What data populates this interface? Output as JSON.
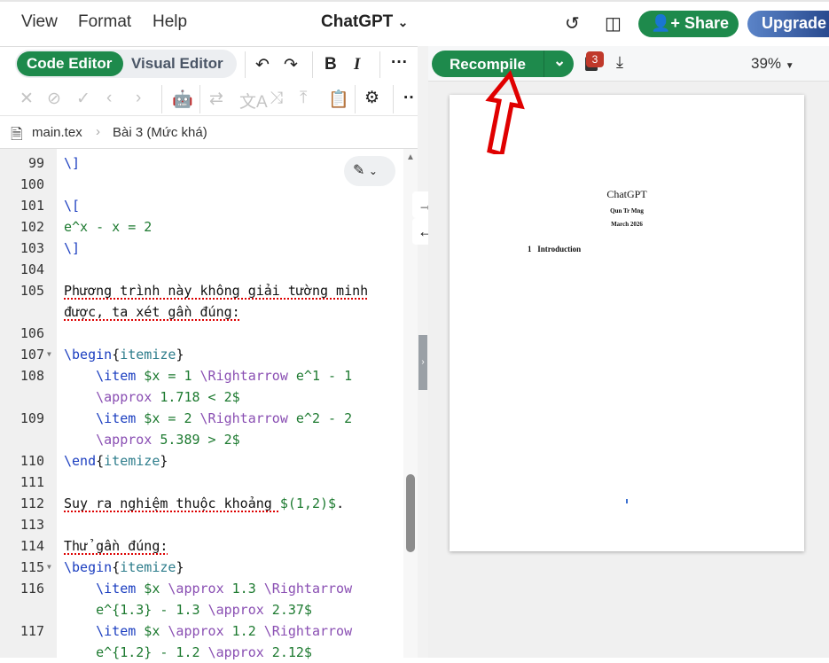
{
  "menu": {
    "items": [
      "View",
      "Format",
      "Help"
    ],
    "project_title": "ChatGPT"
  },
  "header": {
    "share_label": "Share",
    "upgrade_label": "Upgrade"
  },
  "editor": {
    "code_editor_label": "Code Editor",
    "visual_editor_label": "Visual Editor",
    "breadcrumb": {
      "file": "main.tex",
      "section": "Bài 3 (Mức khá)"
    },
    "rows": [
      {
        "num": "99",
        "segs": [
          [
            "\\]",
            "k"
          ]
        ]
      },
      {
        "num": "100",
        "segs": []
      },
      {
        "num": "101",
        "segs": [
          [
            "\\[",
            "k"
          ]
        ]
      },
      {
        "num": "102",
        "segs": [
          [
            "e^x - x = 2",
            "m"
          ]
        ]
      },
      {
        "num": "103",
        "segs": [
          [
            "\\]",
            "k"
          ]
        ]
      },
      {
        "num": "104",
        "segs": []
      },
      {
        "num": "105",
        "segs": [
          [
            "Phương trình này không giải tường minh",
            "sp"
          ]
        ]
      },
      {
        "num": "",
        "segs": [
          [
            "được, ta xét gần đúng:",
            "sp"
          ]
        ]
      },
      {
        "num": "106",
        "segs": []
      },
      {
        "num": "107",
        "fold": true,
        "segs": [
          [
            "\\begin",
            "k"
          ],
          [
            "{",
            ""
          ],
          [
            "itemize",
            "a"
          ],
          [
            "}",
            ""
          ]
        ]
      },
      {
        "num": "108",
        "segs": [
          [
            "    ",
            ""
          ],
          [
            "\\item",
            "k"
          ],
          [
            " $x = 1 ",
            "m"
          ],
          [
            "\\Rightarrow",
            "p"
          ],
          [
            " e^1 - 1",
            "m"
          ]
        ]
      },
      {
        "num": "",
        "segs": [
          [
            "    ",
            ""
          ],
          [
            "\\approx",
            "p"
          ],
          [
            " 1.718 < 2$",
            "m"
          ]
        ]
      },
      {
        "num": "109",
        "segs": [
          [
            "    ",
            ""
          ],
          [
            "\\item",
            "k"
          ],
          [
            " $x = 2 ",
            "m"
          ],
          [
            "\\Rightarrow",
            "p"
          ],
          [
            " e^2 - 2",
            "m"
          ]
        ]
      },
      {
        "num": "",
        "segs": [
          [
            "    ",
            ""
          ],
          [
            "\\approx",
            "p"
          ],
          [
            " 5.389 > 2$",
            "m"
          ]
        ]
      },
      {
        "num": "110",
        "segs": [
          [
            "\\end",
            "k"
          ],
          [
            "{",
            ""
          ],
          [
            "itemize",
            "a"
          ],
          [
            "}",
            ""
          ]
        ]
      },
      {
        "num": "111",
        "segs": []
      },
      {
        "num": "112",
        "segs": [
          [
            "Suy ra nghiệm thuộc khoảng ",
            "sp"
          ],
          [
            "$(1,2)$",
            "m"
          ],
          [
            ".",
            ""
          ]
        ]
      },
      {
        "num": "113",
        "segs": []
      },
      {
        "num": "114",
        "segs": [
          [
            "Thử gần đúng:",
            "sp"
          ]
        ]
      },
      {
        "num": "115",
        "fold": true,
        "segs": [
          [
            "\\begin",
            "k"
          ],
          [
            "{",
            ""
          ],
          [
            "itemize",
            "a"
          ],
          [
            "}",
            ""
          ]
        ]
      },
      {
        "num": "116",
        "segs": [
          [
            "    ",
            ""
          ],
          [
            "\\item",
            "k"
          ],
          [
            " $x ",
            "m"
          ],
          [
            "\\approx",
            "p"
          ],
          [
            " 1.3 ",
            "m"
          ],
          [
            "\\Rightarrow",
            "p"
          ]
        ]
      },
      {
        "num": "",
        "segs": [
          [
            "    ",
            ""
          ],
          [
            "e^{1.3} - 1.3 ",
            "m"
          ],
          [
            "\\approx",
            "p"
          ],
          [
            " 2.37$",
            "m"
          ]
        ]
      },
      {
        "num": "117",
        "segs": [
          [
            "    ",
            ""
          ],
          [
            "\\item",
            "k"
          ],
          [
            " $x ",
            "m"
          ],
          [
            "\\approx",
            "p"
          ],
          [
            " 1.2 ",
            "m"
          ],
          [
            "\\Rightarrow",
            "p"
          ]
        ]
      },
      {
        "num": "",
        "segs": [
          [
            "    ",
            ""
          ],
          [
            "e^{1.2} - 1.2 ",
            "m"
          ],
          [
            "\\approx",
            "p"
          ],
          [
            " 2.12$",
            "m"
          ]
        ]
      }
    ]
  },
  "preview": {
    "recompile_label": "Recompile",
    "log_badge": "3",
    "zoom": "39%",
    "pdf": {
      "title": "ChatGPT",
      "author": "Qun Tr Mng",
      "date": "March 2026",
      "section_num": "1",
      "section_title": "Introduction"
    }
  },
  "colors": {
    "accent": "#1e8a4c",
    "annotation_arrow": "#e00000"
  }
}
